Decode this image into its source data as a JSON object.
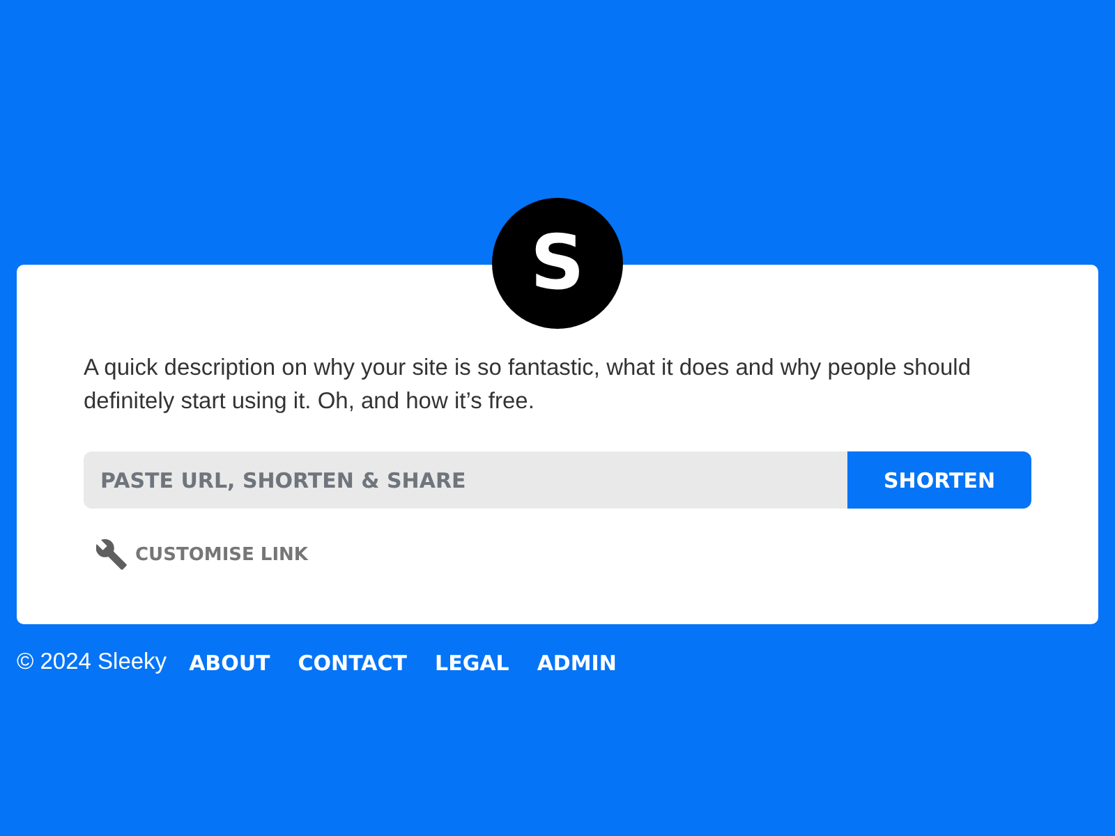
{
  "logo": {
    "letter": "S"
  },
  "description": "A quick description on why your site is so fantastic, what it does and why people should definitely start using it. Oh, and how it’s free.",
  "shorten_form": {
    "url_field": {
      "placeholder": "PASTE URL, SHORTEN & SHARE"
    },
    "button": "SHORTEN",
    "customise_link": "CUSTOMISE LINK"
  },
  "footer": {
    "copyright": "© 2024 Sleeky",
    "links": [
      "ABOUT",
      "CONTACT",
      "LEGAL",
      "ADMIN"
    ]
  }
}
